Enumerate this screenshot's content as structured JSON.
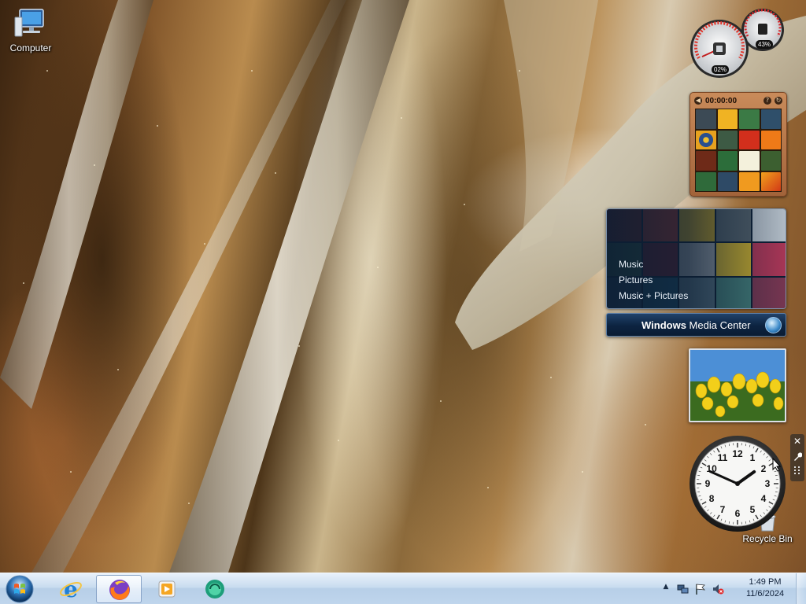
{
  "desktop": {
    "icons": [
      {
        "label": "Computer",
        "icon": "computer-icon"
      },
      {
        "label": "Recycle Bin",
        "icon": "recycle-bin-icon"
      }
    ]
  },
  "gadgets": {
    "cpu_meter": {
      "cpu_percent_text": "02%",
      "memory_percent_text": "43%",
      "cpu_value": 2,
      "memory_value": 43
    },
    "picture_puzzle": {
      "timer": "00:00:00",
      "help_icon": "?",
      "options_icon": "↻"
    },
    "media_center": {
      "menu": [
        "Music",
        "Pictures",
        "Music + Pictures"
      ],
      "banner_bold": "Windows",
      "banner_rest": " Media Center"
    },
    "slideshow": {
      "subject": "tulips"
    },
    "clock": {
      "numbers": [
        "12",
        "1",
        "2",
        "3",
        "4",
        "5",
        "6",
        "7",
        "8",
        "9",
        "10",
        "11"
      ],
      "time": "1:49"
    },
    "controls": {
      "close": "✕",
      "options": "wrench-icon",
      "drag": "grip-icon"
    }
  },
  "taskbar": {
    "start": "start-orb-icon",
    "pinned": [
      {
        "name": "internet-explorer",
        "icon": "ie-icon"
      },
      {
        "name": "firefox",
        "icon": "firefox-icon",
        "active": true
      },
      {
        "name": "media-player",
        "icon": "media-player-icon"
      },
      {
        "name": "app",
        "icon": "green-app-icon"
      }
    ],
    "tray": {
      "show_hidden": "▲",
      "time": "1:49 PM",
      "date": "11/6/2024"
    }
  },
  "colors": {
    "taskbar_top": "#e8f1fb",
    "taskbar_bottom": "#bfd5ec",
    "media_center_bg": "#0c1e33",
    "puzzle_frame": "#c98b5a"
  }
}
